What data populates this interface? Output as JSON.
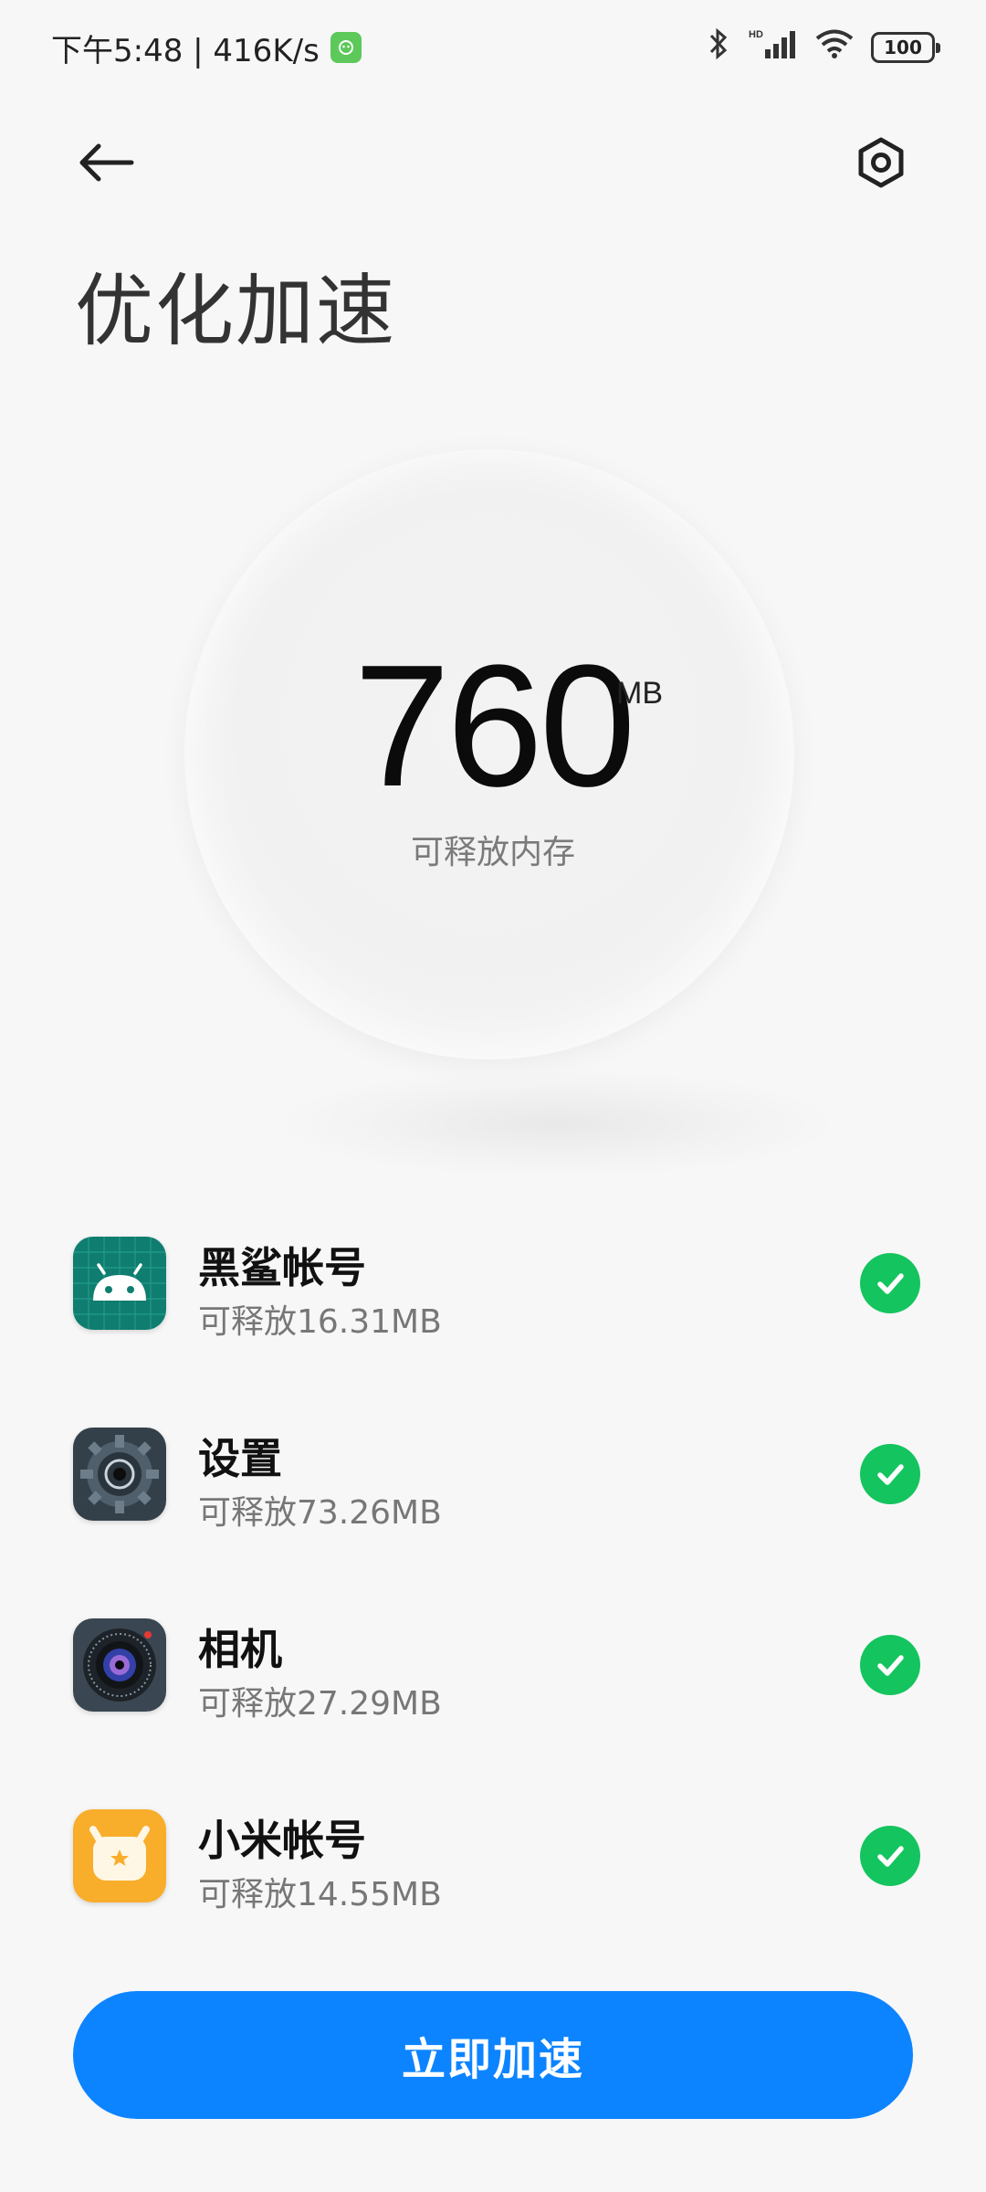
{
  "status_bar": {
    "time": "下午5:48 | 416K/s",
    "battery": "100",
    "icons": [
      "app-badge-icon",
      "bluetooth-icon",
      "signal-icon",
      "wifi-icon",
      "battery-icon"
    ]
  },
  "header": {
    "title": "优化加速",
    "back_icon": "back-arrow-icon",
    "settings_icon": "settings-hexagon-icon"
  },
  "memory": {
    "value": "760",
    "unit": "MB",
    "label": "可释放内存"
  },
  "apps": [
    {
      "name": "黑鲨帐号",
      "size": "可释放16.31MB",
      "icon": "android-icon",
      "checked": true
    },
    {
      "name": "设置",
      "size": "可释放73.26MB",
      "icon": "gear-icon",
      "checked": true
    },
    {
      "name": "相机",
      "size": "可释放27.29MB",
      "icon": "camera-lens-icon",
      "checked": true
    },
    {
      "name": "小米帐号",
      "size": "可释放14.55MB",
      "icon": "mi-account-icon",
      "checked": true
    }
  ],
  "action_button": {
    "label": "立即加速"
  },
  "colors": {
    "accent": "#0d84ff",
    "check": "#14c45e",
    "background": "#f7f7f7"
  }
}
